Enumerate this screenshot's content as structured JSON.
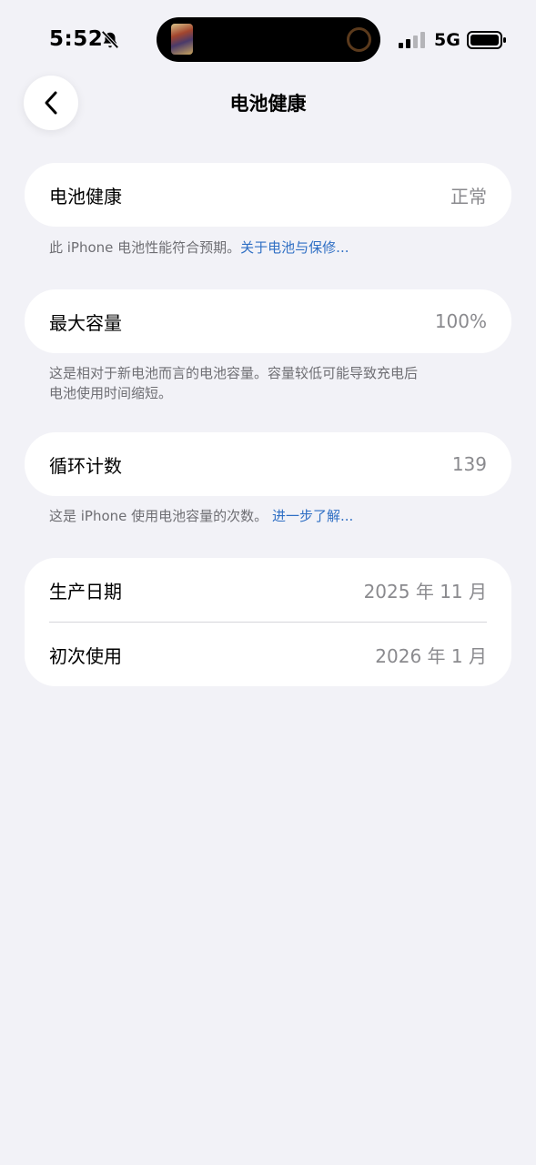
{
  "status_bar": {
    "time": "5:52",
    "network": "5G",
    "icons": [
      "bell-slash-icon",
      "signal-icon",
      "battery-icon"
    ]
  },
  "nav": {
    "back_icon": "chevron-left-icon",
    "title": "电池健康"
  },
  "battery_health": {
    "label": "电池健康",
    "value": "正常",
    "note_text": "此 iPhone 电池性能符合预期。",
    "note_link": "关于电池与保修..."
  },
  "max_capacity": {
    "label": "最大容量",
    "value": "100%",
    "note_line1": "这是相对于新电池而言的电池容量。容量较低可能导致充电后",
    "note_line2": "电池使用时间缩短。"
  },
  "cycle_count": {
    "label": "循环计数",
    "value": "139",
    "note_text": "这是 iPhone 使用电池容量的次数。",
    "note_link": "进一步了解..."
  },
  "dates": {
    "manufacture_label": "生产日期",
    "manufacture_value": "2025 年 11 月",
    "first_use_label": "初次使用",
    "first_use_value": "2026 年 1 月"
  },
  "colors": {
    "background": "#f2f2f7",
    "card": "#ffffff",
    "link": "#2f6fc4",
    "secondary_text": "#8a8a8e"
  }
}
